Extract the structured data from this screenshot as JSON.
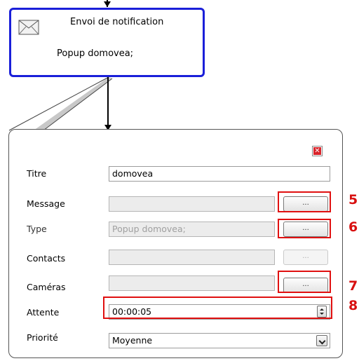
{
  "node": {
    "title": "Envoi de notification",
    "subtitle": "Popup domovea;",
    "icon": "envelope-icon",
    "border_color": "#1a1fd9"
  },
  "form": {
    "close_icon": "close-icon",
    "rows": [
      {
        "label": "Titre",
        "value": "domovea"
      },
      {
        "label": "Message",
        "value": "",
        "button": "..."
      },
      {
        "label": "Type",
        "value": "Popup domovea;",
        "button": "..."
      },
      {
        "label": "Contacts",
        "value": "",
        "button": "..."
      },
      {
        "label": "Caméras",
        "value": "",
        "button": "..."
      },
      {
        "label": "Attente",
        "value": "00:00:05"
      },
      {
        "label": "Priorité",
        "value": "Moyenne"
      }
    ]
  },
  "annotations": {
    "color": "#e01010",
    "numbers": [
      "5",
      "6",
      "7",
      "8"
    ]
  }
}
